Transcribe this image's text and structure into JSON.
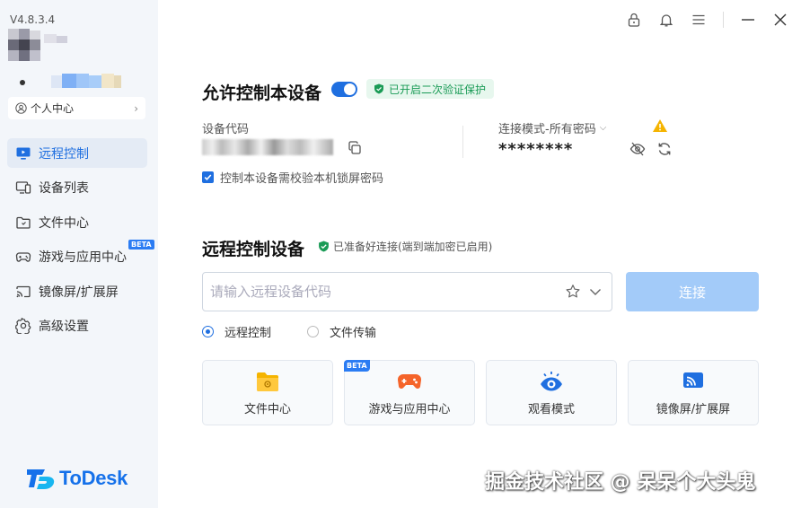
{
  "app": {
    "version": "V4.8.3.4",
    "logo_text": "ToDesk"
  },
  "sidebar": {
    "personal_center": "个人中心",
    "items": [
      {
        "label": "远程控制",
        "icon": "remote-control-icon",
        "active": true
      },
      {
        "label": "设备列表",
        "icon": "device-list-icon"
      },
      {
        "label": "文件中心",
        "icon": "folder-icon"
      },
      {
        "label": "游戏与应用中心",
        "icon": "gamepad-icon",
        "badge": "BETA"
      },
      {
        "label": "镜像屏/扩展屏",
        "icon": "cast-icon"
      },
      {
        "label": "高级设置",
        "icon": "gear-icon"
      }
    ]
  },
  "allow_control": {
    "title": "允许控制本设备",
    "enabled": true,
    "verify_badge": "已开启二次验证保护",
    "device_code_label": "设备代码",
    "mode_label": "连接模式-所有密码",
    "password": "********",
    "lock_screen_checkbox": "控制本设备需校验本机锁屏密码"
  },
  "remote_control": {
    "title": "远程控制设备",
    "status": "已准备好连接(端到端加密已启用)",
    "input_placeholder": "请输入远程设备代码",
    "connect_button": "连接",
    "radio_options": [
      "远程控制",
      "文件传输"
    ],
    "selected_radio": "远程控制"
  },
  "cards": [
    {
      "label": "文件中心",
      "icon": "folder-icon"
    },
    {
      "label": "游戏与应用中心",
      "icon": "gamepad-icon",
      "badge": "BETA"
    },
    {
      "label": "观看模式",
      "icon": "eye-watch-icon"
    },
    {
      "label": "镜像屏/扩展屏",
      "icon": "cast-icon"
    }
  ],
  "watermark": "掘金技术社区 @ 呆呆个大头鬼",
  "colors": {
    "accent": "#1f6fe0",
    "connect_disabled": "#a3cbf9",
    "success": "#1a9b56",
    "warning": "#f5b400"
  }
}
